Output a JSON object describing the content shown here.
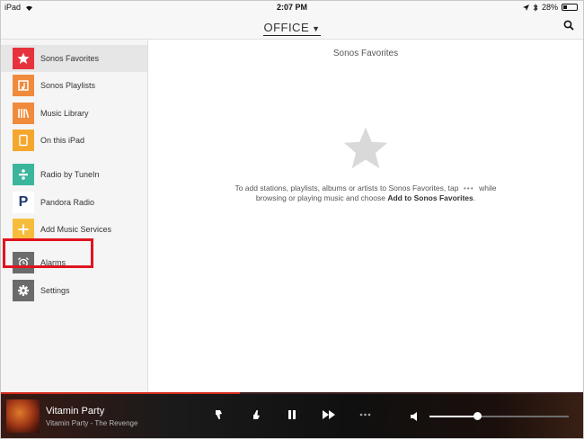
{
  "status_bar": {
    "device": "iPad",
    "time": "2:07 PM",
    "battery_percent": "28%",
    "battery_level": 0.28
  },
  "nav": {
    "room_name": "OFFICE"
  },
  "sidebar": {
    "items": [
      {
        "label": "Sonos Favorites",
        "icon": "star-icon",
        "color": "#e5323d",
        "active": true
      },
      {
        "label": "Sonos Playlists",
        "icon": "playlist-icon",
        "color": "#f08a3c"
      },
      {
        "label": "Music Library",
        "icon": "library-icon",
        "color": "#f08a3c"
      },
      {
        "label": "On this iPad",
        "icon": "ipad-icon",
        "color": "#f4a72c"
      },
      {
        "label": "Radio by TuneIn",
        "icon": "tunein-icon",
        "color": "#3bb59c"
      },
      {
        "label": "Pandora Radio",
        "icon": "pandora-icon",
        "color": "#ffffff"
      },
      {
        "label": "Add Music Services",
        "icon": "plus-icon",
        "color": "#f6bd3c"
      },
      {
        "label": "Alarms",
        "icon": "alarm-icon",
        "color": "#6b6b6b"
      },
      {
        "label": "Settings",
        "icon": "gear-icon",
        "color": "#6b6b6b"
      }
    ]
  },
  "main": {
    "title": "Sonos Favorites",
    "empty_line1_before": "To add stations, playlists, albums or artists to Sonos Favorites, tap",
    "empty_dots": "•••",
    "empty_line1_after": "while",
    "empty_line2_before": "browsing or playing music and choose",
    "empty_line2_bold": "Add to Sonos Favorites",
    "empty_line2_after": "."
  },
  "now_playing": {
    "track": "Vitamin Party",
    "subtitle": "Vitamin Party - The Revenge",
    "progress": 0.41,
    "volume": 0.34
  }
}
